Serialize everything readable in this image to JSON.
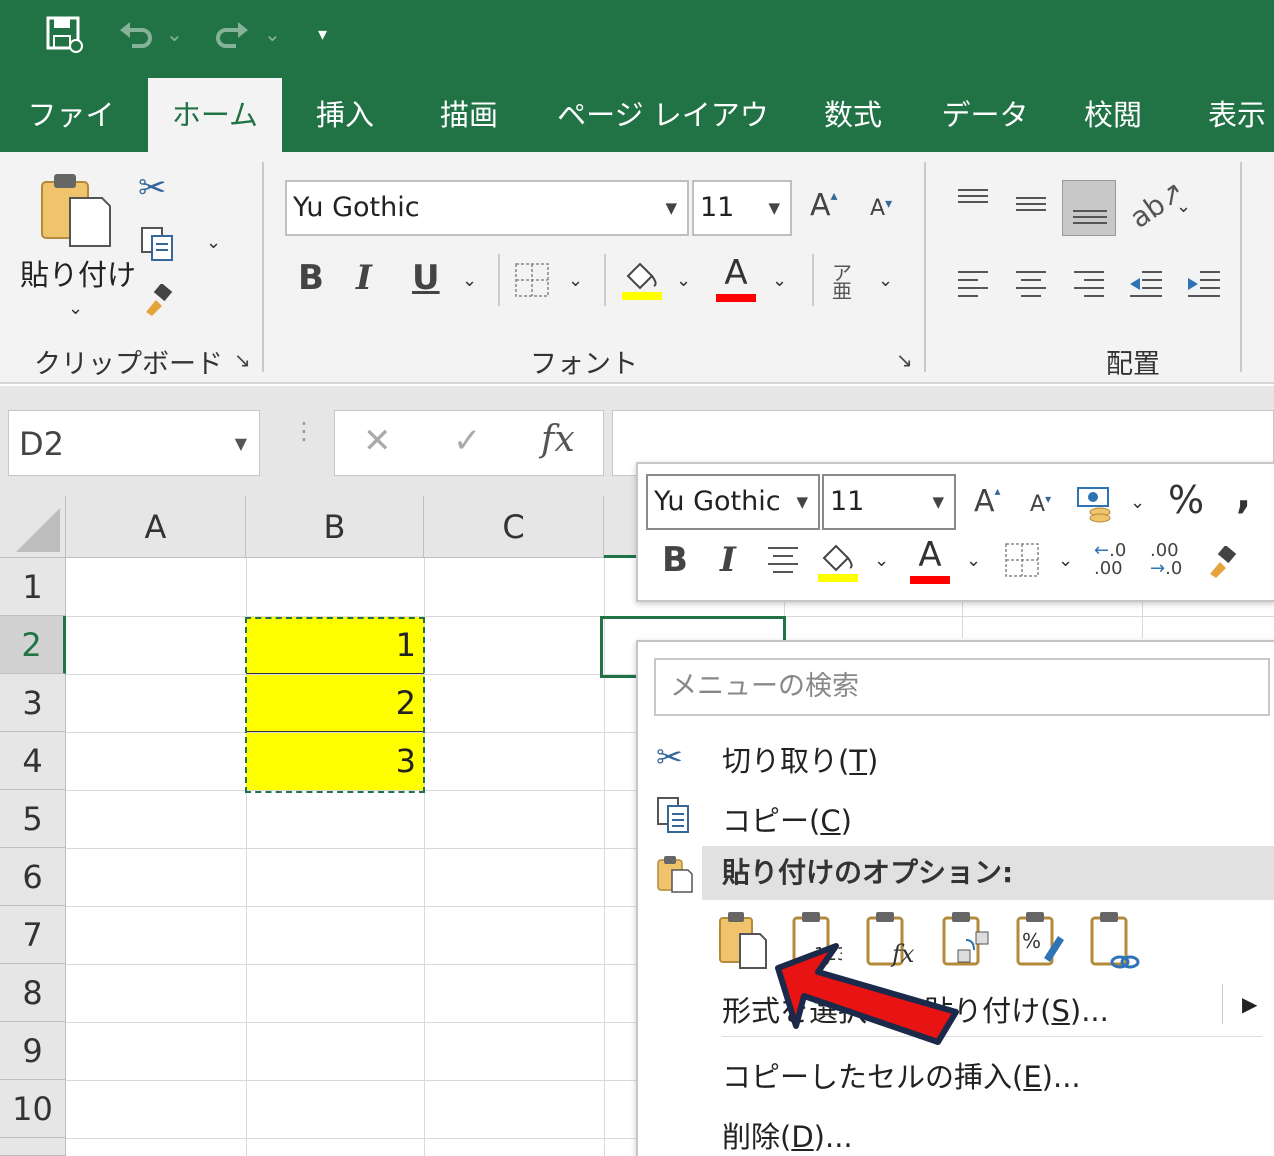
{
  "quick_access": {
    "save_icon": "save-icon",
    "undo_icon": "undo-icon",
    "redo_icon": "redo-icon",
    "customize_icon": "customize-qat-icon"
  },
  "tabs": [
    {
      "label": "ファイル"
    },
    {
      "label": "ホーム"
    },
    {
      "label": "挿入"
    },
    {
      "label": "描画"
    },
    {
      "label": "ページ レイアウト"
    },
    {
      "label": "数式"
    },
    {
      "label": "データ"
    },
    {
      "label": "校閲"
    },
    {
      "label": "表示"
    }
  ],
  "ribbon": {
    "clipboard": {
      "paste_label": "貼り付け",
      "group_label": "クリップボード"
    },
    "font": {
      "font_name": "Yu Gothic",
      "font_size": "11",
      "bold": "B",
      "italic": "I",
      "underline": "U",
      "font_color_glyph": "A",
      "grow_glyph": "A",
      "shrink_glyph": "A",
      "group_label": "フォント",
      "fill_color": "#ffff00",
      "font_color": "#ff0000"
    },
    "alignment": {
      "group_label": "配置"
    }
  },
  "formula_bar": {
    "name_box": "D2",
    "cancel": "✕",
    "enter": "✓",
    "fx": "fx",
    "formula": ""
  },
  "sheet": {
    "columns": [
      "A",
      "B",
      "C"
    ],
    "rows": [
      "1",
      "2",
      "3",
      "4",
      "5",
      "6",
      "7",
      "8",
      "9",
      "10"
    ],
    "selected_row": "2",
    "cells": [
      {
        "ref": "B2",
        "value": "1"
      },
      {
        "ref": "B3",
        "value": "2"
      },
      {
        "ref": "B4",
        "value": "3"
      }
    ],
    "highlight_color": "#ffff00"
  },
  "mini_toolbar": {
    "font_name": "Yu Gothic",
    "font_size": "11",
    "bold": "B",
    "italic": "I",
    "font_color_glyph": "A",
    "grow_glyph": "A",
    "shrink_glyph": "A",
    "percent": "%",
    "comma": ",",
    "inc_decimal": "←.0 .00",
    "dec_decimal": ".00 →.0"
  },
  "context_menu": {
    "search_placeholder": "メニューの検索",
    "cut": {
      "pre": "切り取り(",
      "key": "T",
      "post": ")"
    },
    "copy": {
      "pre": "コピー(",
      "key": "C",
      "post": ")"
    },
    "paste_options_header": "貼り付けのオプション:",
    "paste_special": {
      "pre": "形式を選択して貼り付け(",
      "key": "S",
      "post": ")..."
    },
    "insert_copied": {
      "pre": "コピーしたセルの挿入(",
      "key": "E",
      "post": ")..."
    },
    "delete": {
      "pre": "削除(",
      "key": "D",
      "post": ")..."
    }
  },
  "annotation": {
    "arrow_color": "#e81313",
    "arrow_outline": "#1b2a4a"
  }
}
